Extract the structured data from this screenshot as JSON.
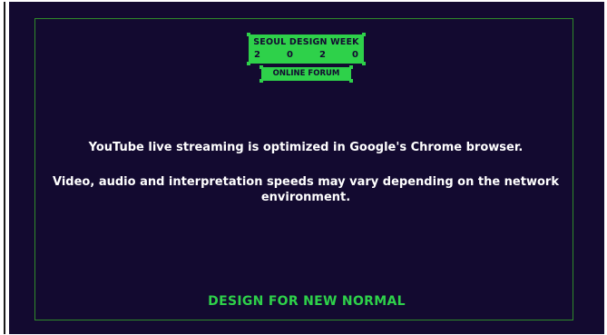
{
  "logo": {
    "title": "SEOUL DESIGN WEEK",
    "year_digits": [
      "2",
      "0",
      "2",
      "0"
    ],
    "subtitle": "ONLINE FORUM"
  },
  "notices": [
    "YouTube live streaming is optimized in Google's Chrome browser.",
    "Video, audio and interpretation speeds may vary depending on the network environment."
  ],
  "tagline": "DESIGN FOR NEW NORMAL",
  "colors": {
    "background": "#130a30",
    "accent_green": "#2ed14a",
    "text": "#ffffff"
  }
}
